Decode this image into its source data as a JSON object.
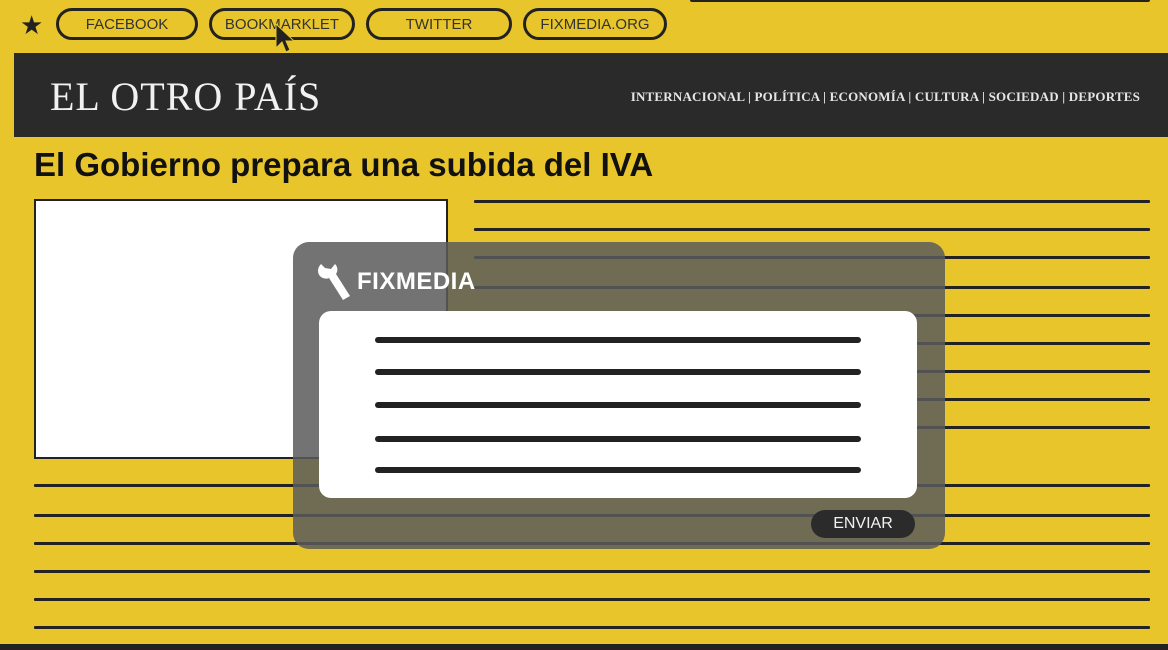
{
  "bookmarks": {
    "star_icon": "star-icon",
    "items": [
      {
        "label": "FACEBOOK"
      },
      {
        "label": "BOOKMARKLET"
      },
      {
        "label": "TWITTER"
      },
      {
        "label": "FIXMEDIA.ORG"
      }
    ]
  },
  "masthead": {
    "brand": "EL OTRO PAÍS",
    "sections": "INTERNACIONAL | POLÍTICA | ECONOMÍA |  CULTURA | SOCIEDAD | DEPORTES"
  },
  "article": {
    "headline": "El Gobierno prepara una subida del IVA"
  },
  "fixmedia": {
    "title": "FIXMEDIA",
    "icon": "wrench-icon",
    "submit_label": "ENVIAR"
  },
  "colors": {
    "page_background": "#e8c52a",
    "masthead_background": "#2a2a2a"
  }
}
